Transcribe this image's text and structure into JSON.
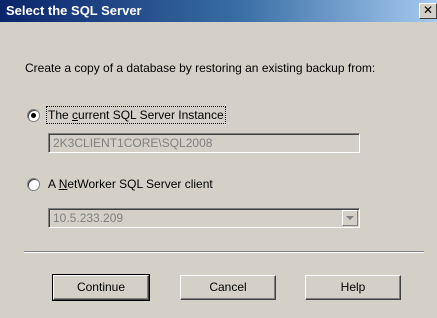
{
  "window": {
    "title": "Select the SQL Server",
    "close_glyph": "✕"
  },
  "instruction": "Create a copy of a database by restoring an existing backup from:",
  "option_current": {
    "selected": true,
    "label_pre": "The ",
    "label_key": "c",
    "label_post": "urrent SQL Server Instance",
    "field_value": "2K3CLIENT1CORE\\SQL2008"
  },
  "option_networker": {
    "selected": false,
    "label_pre": "A ",
    "label_key": "N",
    "label_post": "etWorker SQL Server client",
    "field_value": "10.5.233.209",
    "dropdown_icon": "chevron-down-icon"
  },
  "buttons": {
    "continue": "Continue",
    "cancel": "Cancel",
    "help": "Help"
  },
  "colors": {
    "titlebar_start": "#0a246a",
    "titlebar_end": "#a6caf0",
    "dialog_bg": "#d4d0c8",
    "disabled_text": "#808080"
  }
}
